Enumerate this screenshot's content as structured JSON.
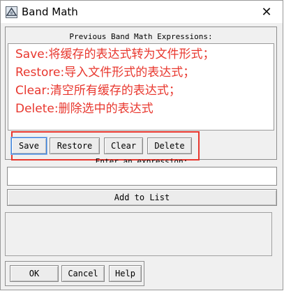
{
  "window": {
    "title": "Band Math",
    "close_glyph": "✕",
    "icon": "band-math-app-icon"
  },
  "expressions": {
    "label": "Previous Band Math Expressions:",
    "annotation": {
      "color": "#e8372e",
      "lines": [
        "Save:将缓存的表达式转为文件形式；",
        "Restore:导入文件形式的表达式；",
        "Clear:清空所有缓存的表达式；",
        "Delete:删除选中的表达式"
      ]
    },
    "buttons": {
      "save": "Save",
      "restore": "Restore",
      "clear": "Clear",
      "delete": "Delete"
    }
  },
  "expression_entry": {
    "label": "Enter an expression:",
    "value": "",
    "add_button": "Add to List"
  },
  "footer": {
    "ok": "OK",
    "cancel": "Cancel",
    "help": "Help"
  }
}
